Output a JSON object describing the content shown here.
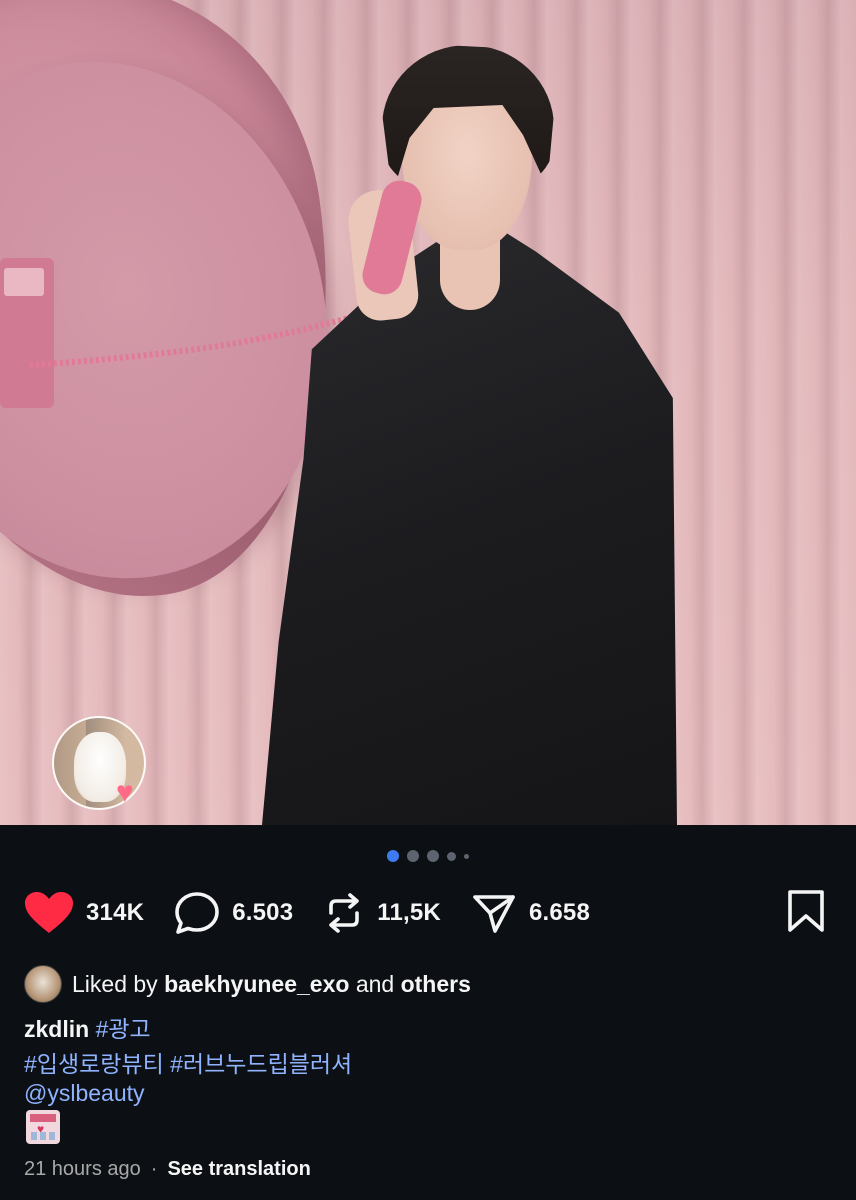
{
  "post": {
    "carousel": {
      "total": 5,
      "active_index": 0
    },
    "actions": {
      "likes": "314K",
      "comments": "6.503",
      "reposts": "11,5K",
      "shares": "6.658"
    },
    "liked_by": {
      "prefix": "Liked by",
      "user": "baekhyunee_exo",
      "connector": "and",
      "others": "others"
    },
    "caption": {
      "username": "zkdlin",
      "tag1": "#광고",
      "tags_line": "#입생로랑뷰티 #러브누드립블러셔",
      "mention": "@yslbeauty"
    },
    "time": "21 hours ago",
    "separator": "·",
    "translation": "See translation"
  },
  "colors": {
    "background": "#0c1014",
    "like_red": "#ff2b45",
    "link_blue": "#8fb3ff",
    "dot_active": "#3d7cf0"
  },
  "icons": [
    "heart-filled-icon",
    "comment-icon",
    "repost-icon",
    "share-icon",
    "bookmark-icon",
    "love-hotel-emoji"
  ]
}
